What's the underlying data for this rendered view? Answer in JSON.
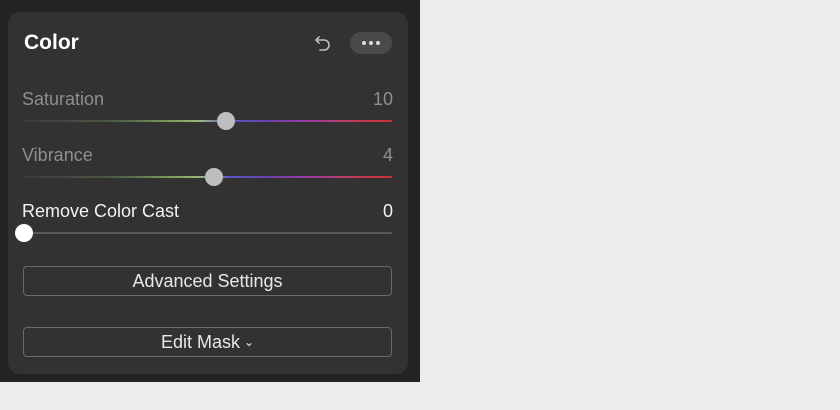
{
  "panel": {
    "title": "Color"
  },
  "header": {
    "undo_icon": "undo-arrow-icon",
    "more_icon": "ellipsis-icon"
  },
  "sliders": [
    {
      "label": "Saturation",
      "value": "10",
      "position": 0.55
    },
    {
      "label": "Vibrance",
      "value": "4",
      "position": 0.52
    },
    {
      "label": "Remove Color Cast",
      "value": "0",
      "position": 0.0
    }
  ],
  "buttons": {
    "advanced": "Advanced Settings",
    "edit_mask": "Edit Mask",
    "edit_mask_chevron": "⌄"
  },
  "colors": {
    "panel_bg": "#323232",
    "app_bg": "#232323",
    "page_bg": "#ececec"
  }
}
